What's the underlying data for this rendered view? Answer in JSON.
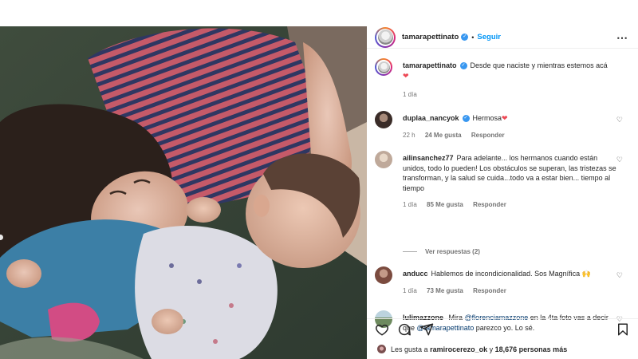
{
  "header": {
    "username": "tamarapettinato",
    "separator": "•",
    "follow_label": "Seguir",
    "more_icon": "⋯"
  },
  "caption": {
    "username": "tamarapettinato",
    "text": "Desde que naciste y mientras estemos acá",
    "time": "1 día"
  },
  "comments": [
    {
      "username": "duplaa_nancyok",
      "text": "Hermosa",
      "time": "22 h",
      "likes": "24 Me gusta",
      "reply": "Responder"
    },
    {
      "username": "ailinsanchez77",
      "text": "Para adelante... los hermanos cuando están unidos, todo lo pueden! Los obstáculos se superan, las tristezas se transforman, y la salud se cuida...todo va a estar bien... tiempo al tiempo",
      "time": "1 día",
      "likes": "85 Me gusta",
      "reply": "Responder"
    },
    {
      "username": "anducc",
      "text": "Hablemos de incondicionalidad. Sos Magnífica",
      "time": "1 día",
      "likes": "73 Me gusta",
      "reply": "Responder"
    },
    {
      "username": "lulimazzone",
      "text_before": "Mira",
      "mention1": "@florenciamazzone",
      "text_middle": "en la 4ta foto vas a decir que",
      "mention2": "@tamarapettinato",
      "text_after": "parezco yo. Lo sé."
    }
  ],
  "view_replies": "Ver respuestas (2)",
  "likes_line": {
    "prefix": "Les gusta a",
    "user": "ramirocerezo_ok",
    "middle": "y",
    "count": "18,676 personas más"
  },
  "colors": {
    "accent": "#0095f6",
    "verified": "#3897f0",
    "heart": "#ed4956"
  }
}
